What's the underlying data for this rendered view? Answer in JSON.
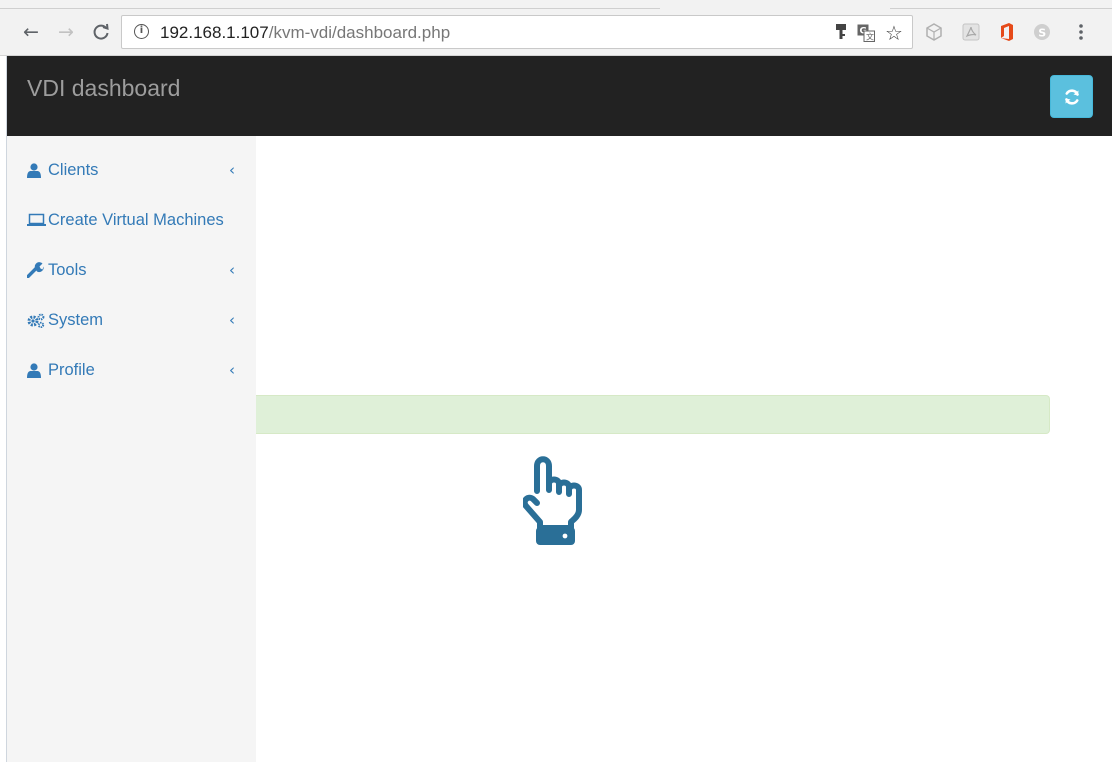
{
  "browser": {
    "back_icon": "arrow-left-icon",
    "forward_icon": "arrow-right-icon",
    "reload_icon": "reload-icon",
    "address": {
      "host": "192.168.1.107",
      "path": "/kvm-vdi/dashboard.php"
    },
    "toolbar_icons": [
      "key-icon",
      "translate-icon",
      "star-icon",
      "extension-cube-icon",
      "pdf-extension-icon",
      "office-extension-icon",
      "skype-extension-icon",
      "menu-dots-icon"
    ]
  },
  "app": {
    "brand": "VDI dashboard",
    "refresh_icon": "refresh-icon",
    "colors": {
      "navbar": "#222222",
      "refresh_button": "#5bc0de",
      "link": "#337ab7",
      "sidebar": "#f5f5f5",
      "alert": "#dff0d8",
      "hand_icon": "#2a6f97"
    }
  },
  "sidebar": {
    "items": [
      {
        "label": "Clients",
        "icon": "user-icon",
        "expandable": true
      },
      {
        "label": "Create Virtual Machines",
        "icon": "laptop-icon",
        "expandable": false
      },
      {
        "label": "Tools",
        "icon": "wrench-icon",
        "expandable": true
      },
      {
        "label": "System",
        "icon": "gears-icon",
        "expandable": true
      },
      {
        "label": "Profile",
        "icon": "user-icon",
        "expandable": true
      }
    ],
    "chevron": "‹"
  },
  "main": {
    "alert_text": "",
    "pointer_icon": "hand-pointer-icon"
  }
}
